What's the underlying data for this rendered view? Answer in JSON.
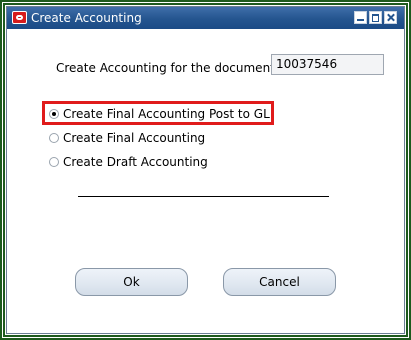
{
  "window": {
    "title": "Create Accounting"
  },
  "document": {
    "label": "Create Accounting for the document:",
    "value": "10037546"
  },
  "options": [
    {
      "label": "Create Final Accounting Post to GL",
      "selected": true
    },
    {
      "label": "Create Final Accounting",
      "selected": false
    },
    {
      "label": "Create Draft Accounting",
      "selected": false
    }
  ],
  "buttons": {
    "ok": "Ok",
    "cancel": "Cancel"
  },
  "colors": {
    "titlebar": "#24558f",
    "highlight": "#e01b1b",
    "frame": "#1d5a1d"
  },
  "icons": {
    "app": "oracle-logo-icon",
    "minimize": "minimize-icon",
    "maximize": "maximize-icon",
    "close": "close-icon"
  }
}
